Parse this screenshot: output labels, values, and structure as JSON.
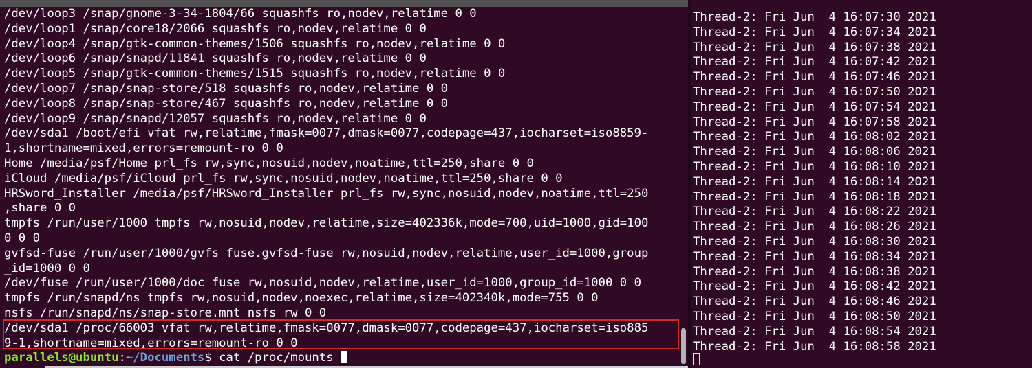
{
  "left_terminal": {
    "lines": [
      "/dev/loop3 /snap/gnome-3-34-1804/66 squashfs ro,nodev,relatime 0 0",
      "/dev/loop1 /snap/core18/2066 squashfs ro,nodev,relatime 0 0",
      "/dev/loop4 /snap/gtk-common-themes/1506 squashfs ro,nodev,relatime 0 0",
      "/dev/loop6 /snap/snapd/11841 squashfs ro,nodev,relatime 0 0",
      "/dev/loop5 /snap/gtk-common-themes/1515 squashfs ro,nodev,relatime 0 0",
      "/dev/loop7 /snap/snap-store/518 squashfs ro,nodev,relatime 0 0",
      "/dev/loop8 /snap/snap-store/467 squashfs ro,nodev,relatime 0 0",
      "/dev/loop9 /snap/snapd/12057 squashfs ro,nodev,relatime 0 0",
      "/dev/sda1 /boot/efi vfat rw,relatime,fmask=0077,dmask=0077,codepage=437,iocharset=iso8859-",
      "1,shortname=mixed,errors=remount-ro 0 0",
      "Home /media/psf/Home prl_fs rw,sync,nosuid,nodev,noatime,ttl=250,share 0 0",
      "iCloud /media/psf/iCloud prl_fs rw,sync,nosuid,nodev,noatime,ttl=250,share 0 0",
      "HRSword_Installer /media/psf/HRSword_Installer prl_fs rw,sync,nosuid,nodev,noatime,ttl=250",
      ",share 0 0",
      "tmpfs /run/user/1000 tmpfs rw,nosuid,nodev,relatime,size=402336k,mode=700,uid=1000,gid=100",
      "0 0 0",
      "gvfsd-fuse /run/user/1000/gvfs fuse.gvfsd-fuse rw,nosuid,nodev,relatime,user_id=1000,group",
      "_id=1000 0 0",
      "/dev/fuse /run/user/1000/doc fuse rw,nosuid,nodev,relatime,user_id=1000,group_id=1000 0 0",
      "tmpfs /run/snapd/ns tmpfs rw,nosuid,nodev,noexec,relatime,size=402340k,mode=755 0 0",
      "nsfs /run/snapd/ns/snap-store.mnt nsfs rw 0 0",
      "/dev/sda1 /proc/66003 vfat rw,relatime,fmask=0077,dmask=0077,codepage=437,iocharset=iso885",
      "9-1,shortname=mixed,errors=remount-ro 0 0"
    ],
    "prompt": {
      "user_host": "parallels@ubuntu",
      "separator": ":",
      "path": "~/Documents",
      "symbol": "$ ",
      "command": "cat /proc/mounts"
    }
  },
  "right_terminal": {
    "lines": [
      "Thread-2: Fri Jun  4 16:07:30 2021",
      "Thread-2: Fri Jun  4 16:07:34 2021",
      "Thread-2: Fri Jun  4 16:07:38 2021",
      "Thread-2: Fri Jun  4 16:07:42 2021",
      "Thread-2: Fri Jun  4 16:07:46 2021",
      "Thread-2: Fri Jun  4 16:07:50 2021",
      "Thread-2: Fri Jun  4 16:07:54 2021",
      "Thread-2: Fri Jun  4 16:07:58 2021",
      "Thread-2: Fri Jun  4 16:08:02 2021",
      "Thread-2: Fri Jun  4 16:08:06 2021",
      "Thread-2: Fri Jun  4 16:08:10 2021",
      "Thread-2: Fri Jun  4 16:08:14 2021",
      "Thread-2: Fri Jun  4 16:08:18 2021",
      "Thread-2: Fri Jun  4 16:08:22 2021",
      "Thread-2: Fri Jun  4 16:08:26 2021",
      "Thread-2: Fri Jun  4 16:08:30 2021",
      "Thread-2: Fri Jun  4 16:08:34 2021",
      "Thread-2: Fri Jun  4 16:08:38 2021",
      "Thread-2: Fri Jun  4 16:08:42 2021",
      "Thread-2: Fri Jun  4 16:08:46 2021",
      "Thread-2: Fri Jun  4 16:08:50 2021",
      "Thread-2: Fri Jun  4 16:08:54 2021",
      "Thread-2: Fri Jun  4 16:08:58 2021"
    ]
  },
  "colors": {
    "terminal_background": "#300a24",
    "text": "#ffffff",
    "prompt_user": "#8ae234",
    "prompt_path": "#729fcf",
    "highlight_border": "#d6262d"
  }
}
